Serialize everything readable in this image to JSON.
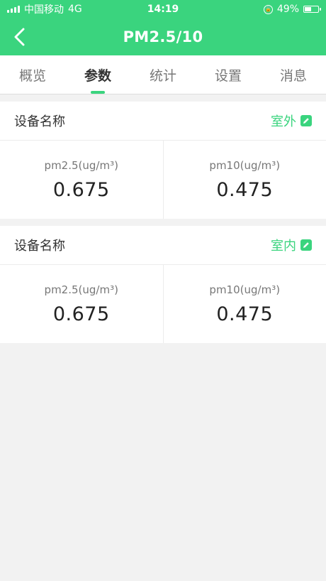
{
  "status_bar": {
    "carrier": "中国移动",
    "network": "4G",
    "time": "14:19",
    "battery_percent": "49%",
    "battery_level": 0.49
  },
  "nav": {
    "title": "PM2.5/10"
  },
  "tabs": [
    {
      "label": "概览"
    },
    {
      "label": "参数"
    },
    {
      "label": "统计"
    },
    {
      "label": "设置"
    },
    {
      "label": "消息"
    }
  ],
  "active_tab": "参数",
  "devices": [
    {
      "name": "设备名称",
      "location": "室外",
      "pm25_label": "pm2.5(ug/m³)",
      "pm25_value": "0.675",
      "pm10_label": "pm10(ug/m³)",
      "pm10_value": "0.475"
    },
    {
      "name": "设备名称",
      "location": "室内",
      "pm25_label": "pm2.5(ug/m³)",
      "pm25_value": "0.675",
      "pm10_label": "pm10(ug/m³)",
      "pm10_value": "0.475"
    }
  ],
  "colors": {
    "accent": "#3ad47e",
    "background": "#f2f2f2"
  }
}
